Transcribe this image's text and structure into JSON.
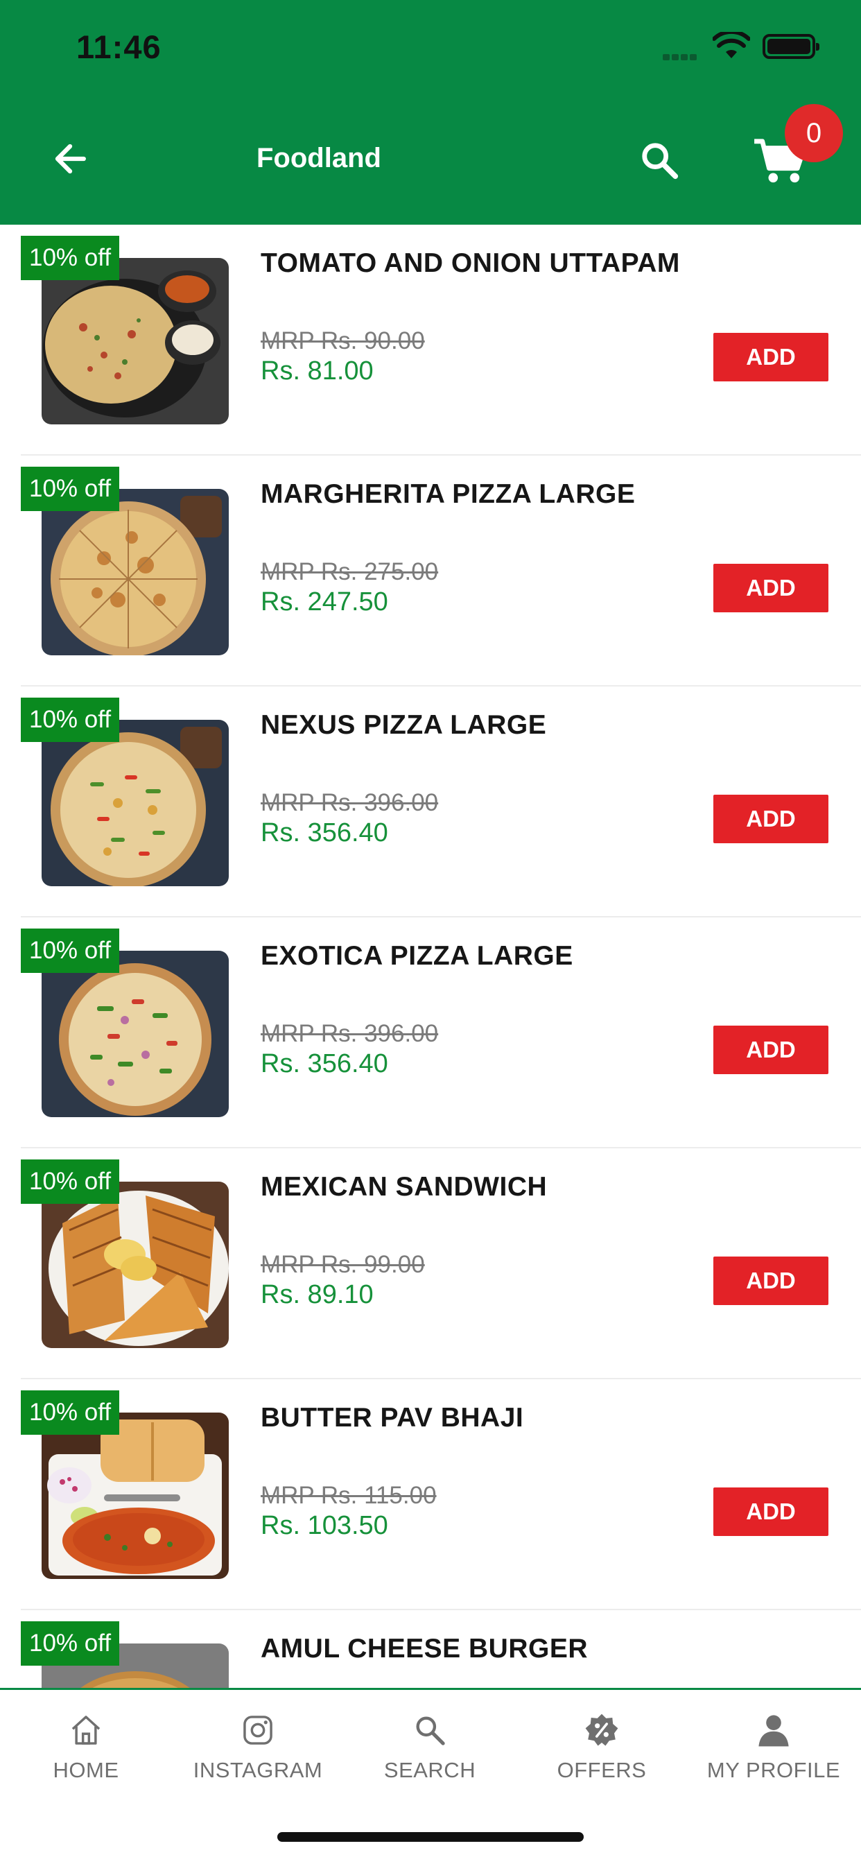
{
  "status_bar": {
    "time": "11:46"
  },
  "header": {
    "title": "Foodland",
    "back_icon": "arrow-left-icon",
    "search_icon": "search-icon",
    "cart_icon": "cart-icon",
    "cart_count": "0",
    "background_color": "#078944",
    "badge_color": "#e02a2a"
  },
  "products": [
    {
      "name": "TOMATO AND ONION UTTAPAM",
      "discount": "10% off",
      "mrp": "MRP Rs. 90.00",
      "price": "Rs. 81.00",
      "add_label": "ADD"
    },
    {
      "name": "MARGHERITA PIZZA LARGE",
      "discount": "10% off",
      "mrp": "MRP Rs. 275.00",
      "price": "Rs. 247.50",
      "add_label": "ADD"
    },
    {
      "name": "NEXUS PIZZA LARGE",
      "discount": "10% off",
      "mrp": "MRP Rs. 396.00",
      "price": "Rs. 356.40",
      "add_label": "ADD"
    },
    {
      "name": "EXOTICA PIZZA LARGE",
      "discount": "10% off",
      "mrp": "MRP Rs. 396.00",
      "price": "Rs. 356.40",
      "add_label": "ADD"
    },
    {
      "name": "MEXICAN SANDWICH",
      "discount": "10% off",
      "mrp": "MRP Rs. 99.00",
      "price": "Rs. 89.10",
      "add_label": "ADD"
    },
    {
      "name": "BUTTER PAV BHAJI",
      "discount": "10% off",
      "mrp": "MRP Rs. 115.00",
      "price": "Rs. 103.50",
      "add_label": "ADD"
    },
    {
      "name": "AMUL CHEESE BURGER",
      "discount": "10% off"
    }
  ],
  "bottom_nav": [
    {
      "label": "HOME",
      "icon": "home-icon"
    },
    {
      "label": "INSTAGRAM",
      "icon": "instagram-icon"
    },
    {
      "label": "SEARCH",
      "icon": "search-icon"
    },
    {
      "label": "OFFERS",
      "icon": "offers-icon"
    },
    {
      "label": "MY PROFILE",
      "icon": "profile-icon"
    }
  ],
  "colors": {
    "accent_green": "#078944",
    "discount_badge": "#0a8a1f",
    "price_green": "#16913a",
    "add_button": "#e32227"
  }
}
